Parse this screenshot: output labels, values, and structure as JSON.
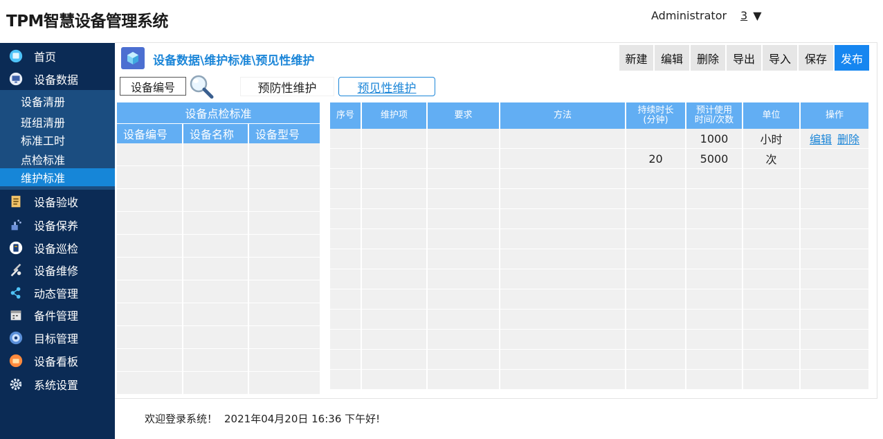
{
  "header": {
    "title": "TPM智慧设备管理系统",
    "user": "Administrator",
    "notification_count": "3",
    "dropdown_glyph": "▼"
  },
  "sidebar": {
    "items": [
      {
        "label": "首页",
        "icon": "home-icon"
      },
      {
        "label": "设备数据",
        "icon": "monitor-icon"
      },
      {
        "label": "设备验收",
        "icon": "clipboard-icon"
      },
      {
        "label": "设备保养",
        "icon": "spray-icon"
      },
      {
        "label": "设备巡检",
        "icon": "inspection-icon"
      },
      {
        "label": "设备维修",
        "icon": "tools-icon"
      },
      {
        "label": "动态管理",
        "icon": "share-icon"
      },
      {
        "label": "备件管理",
        "icon": "calendar-icon"
      },
      {
        "label": "目标管理",
        "icon": "target-icon"
      },
      {
        "label": "设备看板",
        "icon": "dashboard-icon"
      },
      {
        "label": "系统设置",
        "icon": "gear-icon"
      }
    ],
    "submenu": [
      {
        "label": "设备清册"
      },
      {
        "label": "班组清册"
      },
      {
        "label": "标准工时"
      },
      {
        "label": "点检标准"
      },
      {
        "label": "维护标准",
        "active": true
      }
    ]
  },
  "breadcrumb": "设备数据\\维护标准\\预见性维护",
  "toolbar": {
    "buttons": [
      "新建",
      "编辑",
      "删除",
      "导出",
      "导入",
      "保存",
      "发布"
    ]
  },
  "filter": {
    "field_label": "设备编号"
  },
  "tabs": {
    "preventive": "预防性维护",
    "predictive": "预见性维护"
  },
  "left_table": {
    "title": "设备点检标准",
    "headers": [
      "设备编号",
      "设备名称",
      "设备型号"
    ]
  },
  "right_table": {
    "headers": [
      "序号",
      "维护项",
      "要求",
      "方法",
      "持续时长\n(分钟)",
      "预计使用\n时间/次数",
      "单位",
      "操作"
    ],
    "rows": [
      {
        "seq": "",
        "item": "",
        "requirement": "",
        "method": "",
        "duration": "",
        "usage": "1000",
        "unit": "小时",
        "ops": [
          "编辑",
          "删除"
        ]
      },
      {
        "seq": "",
        "item": "",
        "requirement": "",
        "method": "",
        "duration": "20",
        "usage": "5000",
        "unit": "次",
        "ops": []
      }
    ]
  },
  "footer": {
    "welcome": "欢迎登录系统！",
    "datetime": "2021年04月20日 16:36 下午好!"
  },
  "colors": {
    "sidebar_bg": "#0b2b55",
    "submenu_bg": "#1b4d80",
    "active_item": "#1686d8",
    "table_header": "#62aef3",
    "accent": "#1c86d8",
    "publish_button": "#1686f0"
  }
}
